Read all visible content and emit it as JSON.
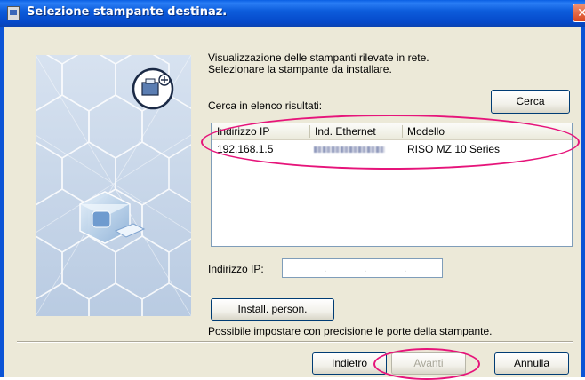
{
  "window": {
    "title": "Selezione stampante destinaz.",
    "close_glyph": "✕"
  },
  "instructions": {
    "line1": "Visualizzazione delle stampanti rilevate in rete.",
    "line2": "Selezionare la stampante da installare."
  },
  "search": {
    "label": "Cerca in elenco risultati:",
    "button": "Cerca"
  },
  "printer_list": {
    "columns": [
      "Indirizzo IP",
      "Ind. Ethernet",
      "Modello"
    ],
    "rows": [
      {
        "ip": "192.168.1.5",
        "ethernet": "",
        "model": "RISO MZ 10 Series"
      }
    ]
  },
  "ip_input": {
    "label": "Indirizzo IP:",
    "value": ""
  },
  "custom_install": {
    "button": "Install. person.",
    "description": "Possibile impostare con precisione le porte della stampante."
  },
  "footer": {
    "back": "Indietro",
    "next": "Avanti",
    "cancel": "Annulla"
  },
  "colors": {
    "highlight_oval": "#e6147a",
    "title_bar": "#0a5fe3",
    "dialog_bg": "#ece9d8"
  }
}
